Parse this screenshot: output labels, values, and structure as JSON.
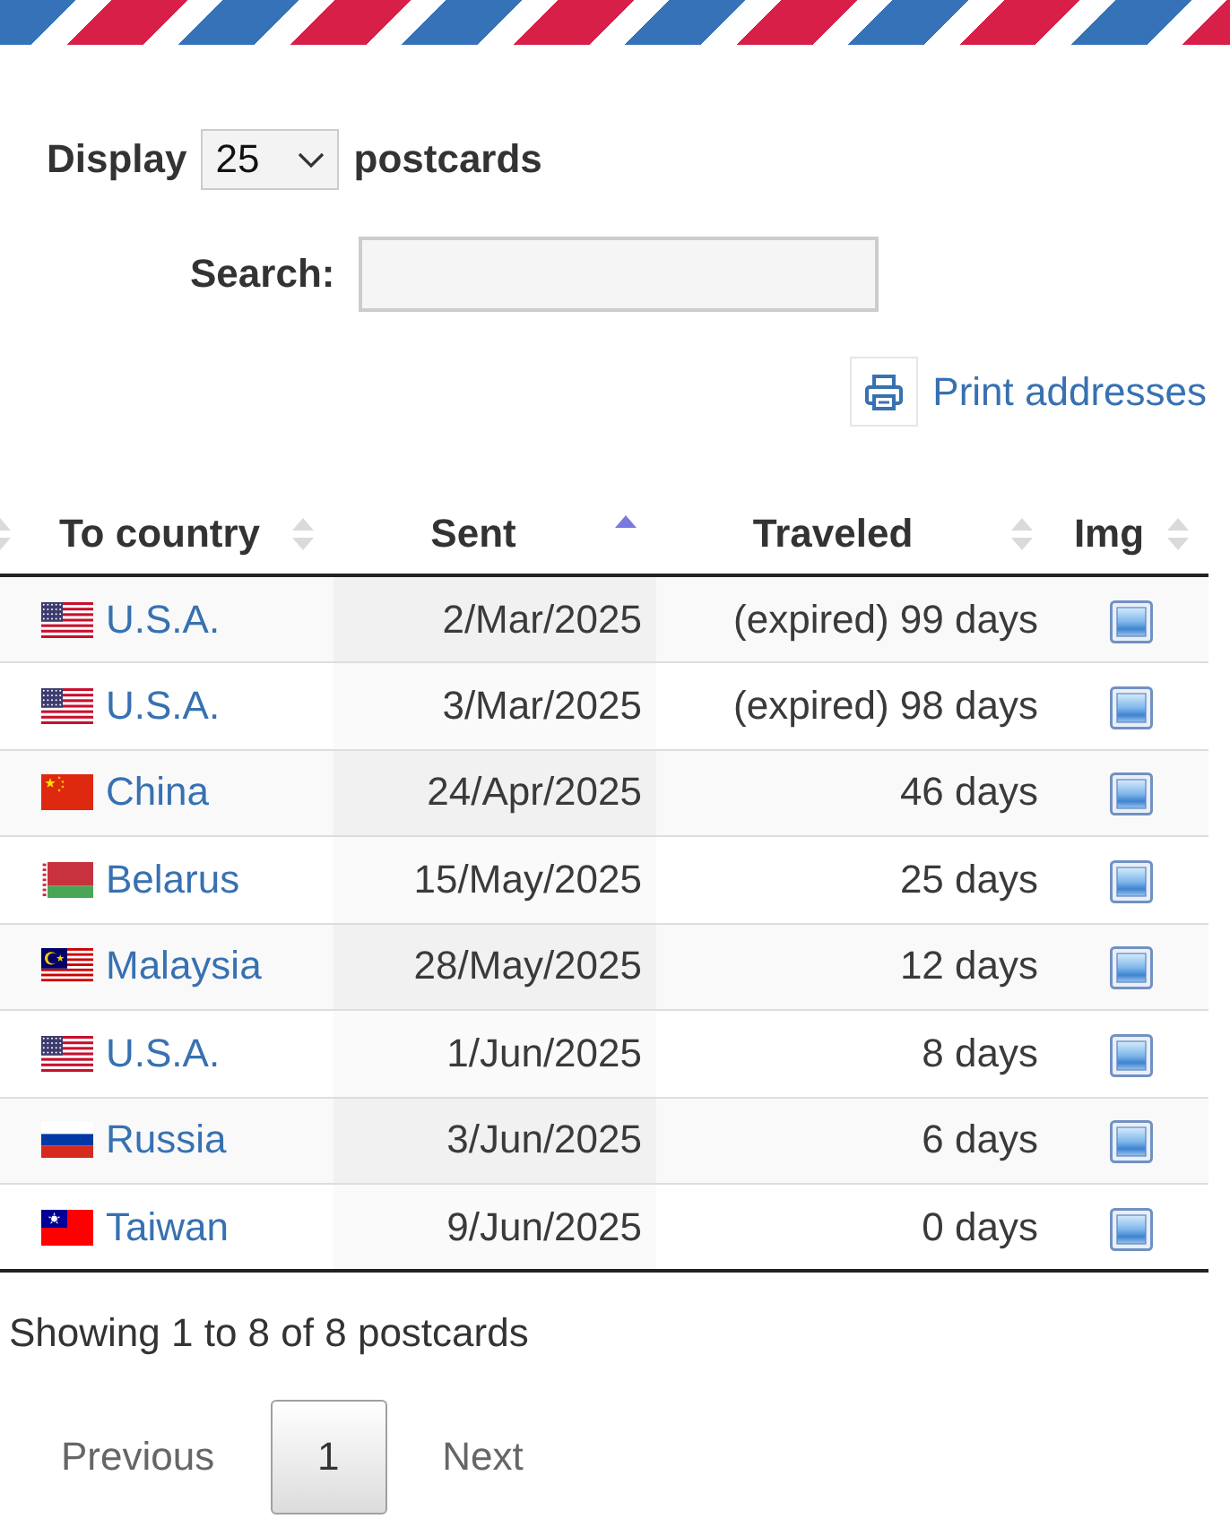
{
  "length_menu": {
    "label_before": "Display",
    "value": "25",
    "label_after": "postcards"
  },
  "search": {
    "label": "Search:"
  },
  "print_link": {
    "label": "Print addresses"
  },
  "table": {
    "columns": [
      {
        "sorted": false
      },
      {
        "label": "To country",
        "sorted": false
      },
      {
        "label": "Sent",
        "sorted": true
      },
      {
        "label": "Traveled",
        "sorted": false
      },
      {
        "label": "Img",
        "sorted": false
      }
    ],
    "rows": [
      {
        "country": "U.S.A.",
        "flag": {
          "kind": "us"
        },
        "sent": "2/Mar/2025",
        "traveled": "(expired) 99 days"
      },
      {
        "country": "U.S.A.",
        "flag": {
          "kind": "us"
        },
        "sent": "3/Mar/2025",
        "traveled": "(expired) 98 days"
      },
      {
        "country": "China",
        "flag": {
          "kind": "cn"
        },
        "sent": "24/Apr/2025",
        "traveled": "46 days"
      },
      {
        "country": "Belarus",
        "flag": {
          "kind": "by"
        },
        "sent": "15/May/2025",
        "traveled": "25 days"
      },
      {
        "country": "Malaysia",
        "flag": {
          "kind": "my"
        },
        "sent": "28/May/2025",
        "traveled": "12 days"
      },
      {
        "country": "U.S.A.",
        "flag": {
          "kind": "us"
        },
        "sent": "1/Jun/2025",
        "traveled": "8 days"
      },
      {
        "country": "Russia",
        "flag": {
          "kind": "ru"
        },
        "sent": "3/Jun/2025",
        "traveled": "6 days"
      },
      {
        "country": "Taiwan",
        "flag": {
          "kind": "tw"
        },
        "sent": "9/Jun/2025",
        "traveled": "0 days"
      }
    ]
  },
  "info": "Showing 1 to 8 of 8 postcards",
  "pagination": {
    "previous": {
      "label": "Previous",
      "disabled": true
    },
    "pages": [
      {
        "label": "1",
        "selected": true
      }
    ],
    "next": {
      "label": "Next",
      "disabled": true
    }
  }
}
